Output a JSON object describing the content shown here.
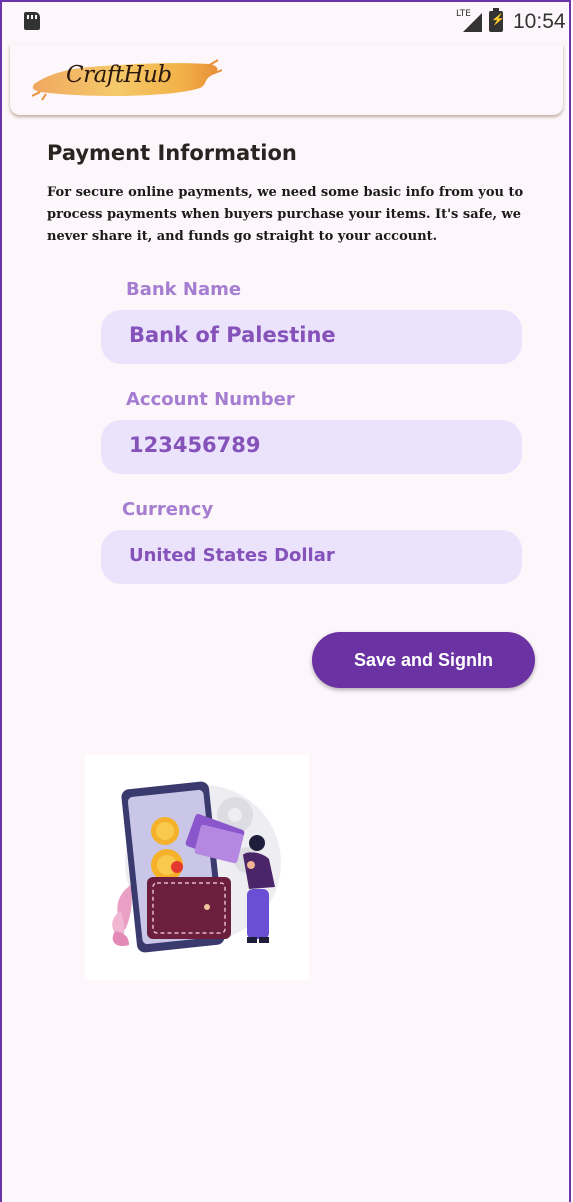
{
  "status_bar": {
    "network": "LTE",
    "time": "10:54"
  },
  "app": {
    "logo_text": "CraftHub"
  },
  "page": {
    "title": "Payment Information",
    "description": "For secure online payments, we need some basic info from you to process payments when buyers purchase your items. It's safe, we never share it, and funds go straight to your account."
  },
  "form": {
    "bank_name": {
      "label": "Bank Name",
      "value": "Bank of Palestine"
    },
    "account_number": {
      "label": "Account Number",
      "value": "123456789"
    },
    "currency": {
      "label": "Currency",
      "value": "United States Dollar"
    }
  },
  "actions": {
    "save_label": "Save and SignIn"
  },
  "colors": {
    "accent": "#6b32a3",
    "field_bg": "#ebe2fc",
    "label": "#a57ed2",
    "background": "#fdf7fb"
  },
  "icons": [
    "sd-card-icon",
    "lte-signal-icon",
    "battery-charging-icon",
    "payment-wallet-illustration"
  ]
}
